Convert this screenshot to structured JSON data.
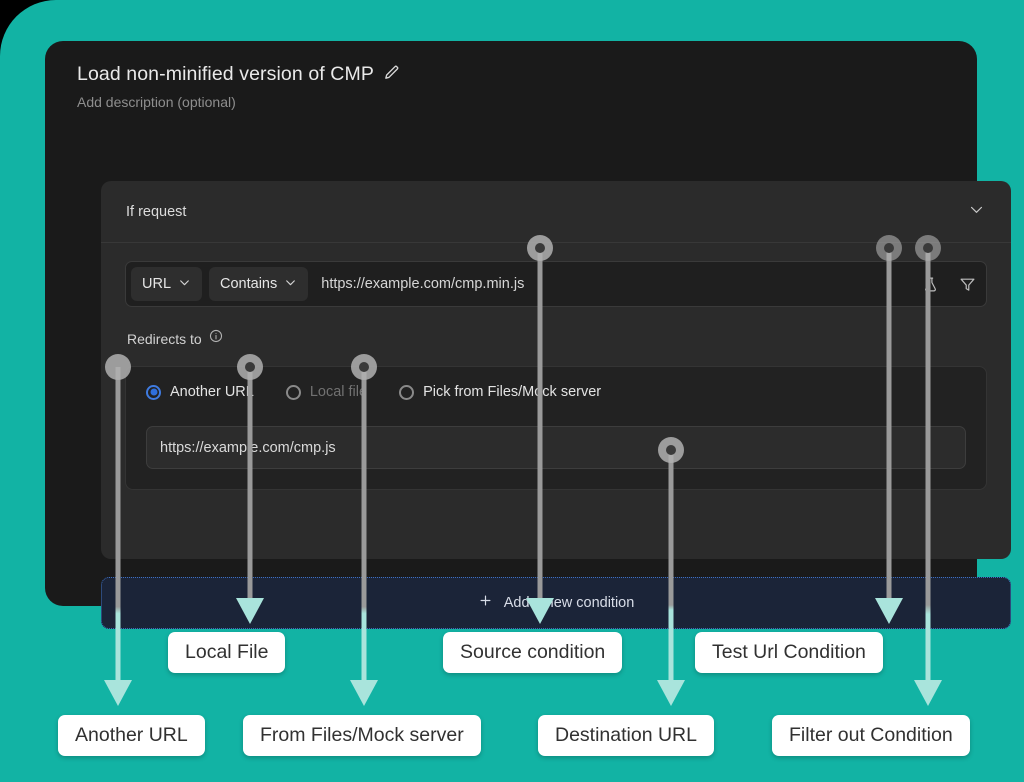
{
  "theme": {
    "backdrop_teal": "#12b3a4",
    "card_bg": "#1a1a1a",
    "panel_bg": "#2b2b2b",
    "accent_blue": "#2f6fdc",
    "annotation_arrow": "#a9e4dc",
    "connector_grey": "#9a9a9a",
    "callout_bg": "#ffffff"
  },
  "card": {
    "title": "Load non-minified version of CMP",
    "edit_icon": "pencil-icon",
    "description_placeholder": "Add description (optional)"
  },
  "if_request": {
    "label": "If request",
    "collapse_icon": "chevron-down-icon"
  },
  "condition": {
    "field_select": {
      "value": "URL",
      "icon": "chevron-down-icon"
    },
    "operator_select": {
      "value": "Contains",
      "icon": "chevron-down-icon"
    },
    "value": "https://example.com/cmp.min.js",
    "test_icon": "flask-icon",
    "filter_icon": "funnel-icon"
  },
  "redirects": {
    "label": "Redirects to",
    "info_icon": "info-icon",
    "options": [
      {
        "label": "Another URL",
        "selected": true,
        "disabled": false
      },
      {
        "label": "Local file",
        "selected": false,
        "disabled": true
      },
      {
        "label": "Pick from Files/Mock server",
        "selected": false,
        "disabled": false
      }
    ],
    "destination_value": "https://example.com/cmp.js"
  },
  "add_condition": {
    "label": "Add a new condition",
    "icon": "plus-icon"
  },
  "annotations": [
    {
      "id": "another-url",
      "label": "Another URL"
    },
    {
      "id": "local-file",
      "label": "Local File"
    },
    {
      "id": "from-files-mock",
      "label": "From Files/Mock server"
    },
    {
      "id": "source-condition",
      "label": "Source condition"
    },
    {
      "id": "destination-url",
      "label": "Destination URL"
    },
    {
      "id": "test-url-condition",
      "label": "Test Url Condition"
    },
    {
      "id": "filter-out-condition",
      "label": "Filter out Condition"
    }
  ]
}
